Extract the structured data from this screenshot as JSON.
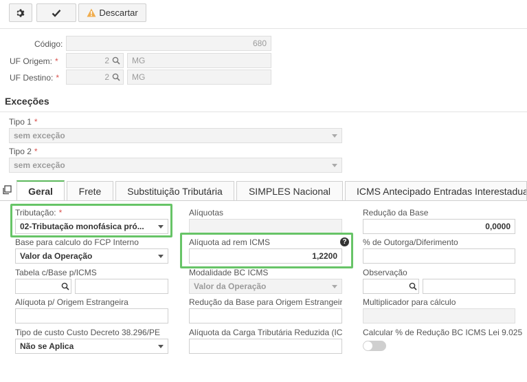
{
  "toolbar": {
    "settings_icon": "gear-icon",
    "confirm_icon": "check-icon",
    "discard_icon": "warning-icon",
    "discard_label": "Descartar"
  },
  "header": {
    "codigo_label": "Código:",
    "codigo_value": "680",
    "uf_origem_label": "UF Origem:",
    "uf_origem_code": "2",
    "uf_origem_name": "MG",
    "uf_destino_label": "UF Destino:",
    "uf_destino_code": "2",
    "uf_destino_name": "MG",
    "required_mark": "*"
  },
  "excecoes": {
    "title": "Exceções",
    "tipo1_label": "Tipo 1",
    "tipo1_value": "sem exceção",
    "tipo2_label": "Tipo 2",
    "tipo2_value": "sem exceção"
  },
  "tabs": [
    {
      "label": "Geral",
      "active": true
    },
    {
      "label": "Frete"
    },
    {
      "label": "Substituição Tributária"
    },
    {
      "label": "SIMPLES Nacional"
    },
    {
      "label": "ICMS Antecipado Entradas Interestaduais"
    }
  ],
  "form": {
    "tributacao_label": "Tributação:",
    "tributacao_value": "02-Tributação monofásica pró...",
    "aliquotas_label": "Alíquotas",
    "reducao_base_label": "Redução da Base",
    "reducao_base_value": "0,0000",
    "base_fcp_label": "Base para calculo do FCP Interno",
    "base_fcp_value": "Valor da Operação",
    "aliquota_ad_rem_label": "Alíquota ad rem ICMS",
    "aliquota_ad_rem_value": "1,2200",
    "outorga_label": "% de Outorga/Diferimento",
    "tabela_base_label": "Tabela c/Base p/ICMS",
    "modalidade_label": "Modalidade BC ICMS",
    "modalidade_value": "Valor da Operação",
    "observacao_label": "Observação",
    "aliquota_origem_label": "Alíquota p/ Origem Estrangeira",
    "reducao_origem_label": "Redução da Base para Origem Estrangeira",
    "multiplicador_label": "Multiplicador para cálculo",
    "tipo_custo_label": "Tipo de custo Custo Decreto 38.296/PE",
    "tipo_custo_value": "Não se Aplica",
    "aliquota_carga_label": "Alíquota da Carga Tributária Reduzida (ICMS)",
    "calcular_reducao_label": "Calcular % de Redução BC ICMS Lei 9.025"
  },
  "colors": {
    "highlight": "#67c467",
    "required": "#d9534f",
    "warning": "#f0ad4e"
  }
}
